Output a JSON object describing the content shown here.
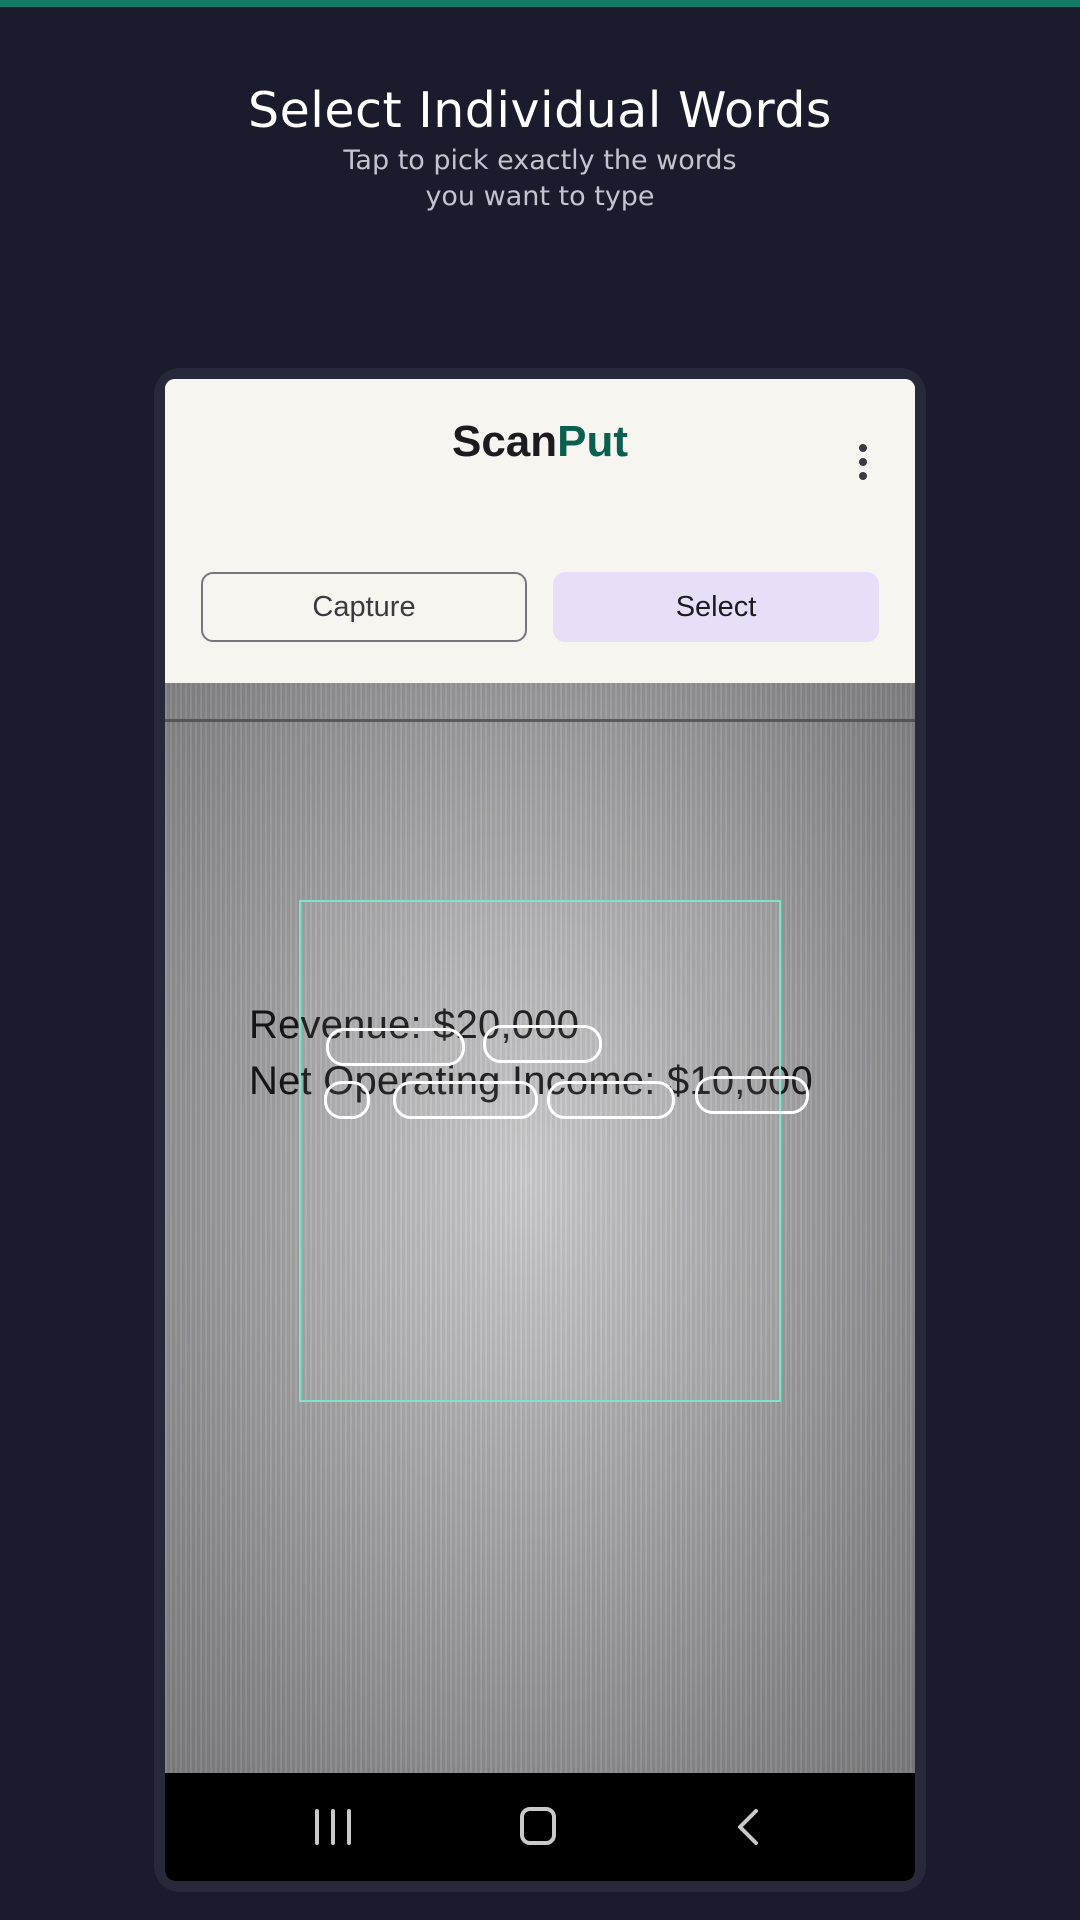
{
  "promo": {
    "title": "Select Individual Words",
    "subtitle_line1": "Tap to pick exactly the words",
    "subtitle_line2": "you want to type"
  },
  "app": {
    "name_part1": "Scan",
    "name_part2": "Put",
    "menu_icon": "more-vert-icon"
  },
  "mode_tabs": {
    "capture_label": "Capture",
    "select_label": "Select",
    "active": "Select"
  },
  "camera_view": {
    "document_lines": [
      "Revenue: $20,000",
      "Net Operating Income: $10,000"
    ],
    "word_highlight_count": 6
  },
  "nav_bar": {
    "recents_icon": "recents-icon",
    "home_icon": "home-icon",
    "back_icon": "back-icon"
  },
  "colors": {
    "background": "#1b1b2e",
    "accent_bar": "#137a66",
    "brand_accent": "#0b5f4f",
    "select_tab": "#e8def8",
    "crop_frame": "#7ae5cc"
  }
}
